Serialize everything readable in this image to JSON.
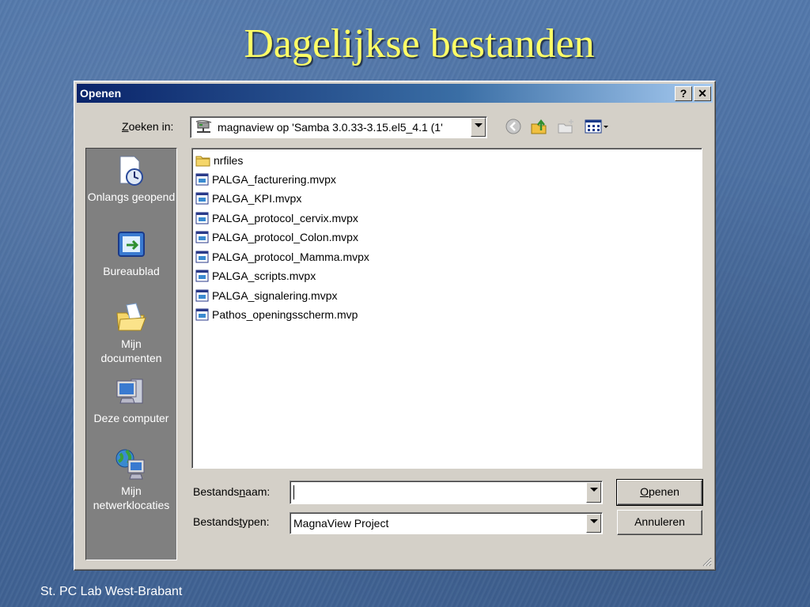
{
  "slide": {
    "title": "Dagelijkse bestanden",
    "footer": "St. PC Lab West-Brabant"
  },
  "dialog": {
    "title": "Openen",
    "help_button": "?",
    "close_button": "✕",
    "look_in_label_prefix": "",
    "look_in_label_key": "Z",
    "look_in_label_rest": "oeken in:",
    "look_in_value": "magnaview op 'Samba 3.0.33-3.15.el5_4.1 (1'",
    "places": [
      {
        "label": "Onlangs geopend",
        "icon": "recent-documents-icon"
      },
      {
        "label": "Bureaublad",
        "icon": "desktop-icon"
      },
      {
        "label": "Mijn documenten",
        "icon": "my-documents-icon"
      },
      {
        "label": "Deze computer",
        "icon": "my-computer-icon"
      },
      {
        "label": "Mijn netwerklocaties",
        "icon": "network-places-icon"
      }
    ],
    "files": [
      {
        "name": "nrfiles",
        "type": "folder"
      },
      {
        "name": "PALGA_facturering.mvpx",
        "type": "file"
      },
      {
        "name": "PALGA_KPI.mvpx",
        "type": "file"
      },
      {
        "name": "PALGA_protocol_cervix.mvpx",
        "type": "file"
      },
      {
        "name": "PALGA_protocol_Colon.mvpx",
        "type": "file"
      },
      {
        "name": "PALGA_protocol_Mamma.mvpx",
        "type": "file"
      },
      {
        "name": "PALGA_scripts.mvpx",
        "type": "file"
      },
      {
        "name": "PALGA_signalering.mvpx",
        "type": "file"
      },
      {
        "name": "Pathos_openingsscherm.mvp",
        "type": "file"
      }
    ],
    "filename_label_a": "Bestands",
    "filename_label_key": "n",
    "filename_label_b": "aam:",
    "filename_value": "",
    "filetype_label_a": "Bestands",
    "filetype_label_key": "t",
    "filetype_label_b": "ypen:",
    "filetype_value": "MagnaView Project",
    "open_button_key": "O",
    "open_button_rest": "penen",
    "cancel_button": "Annuleren"
  },
  "colors": {
    "titlebar_start": "#0a246a",
    "title_text": "#ffff66",
    "dialog_face": "#d4d0c8"
  }
}
